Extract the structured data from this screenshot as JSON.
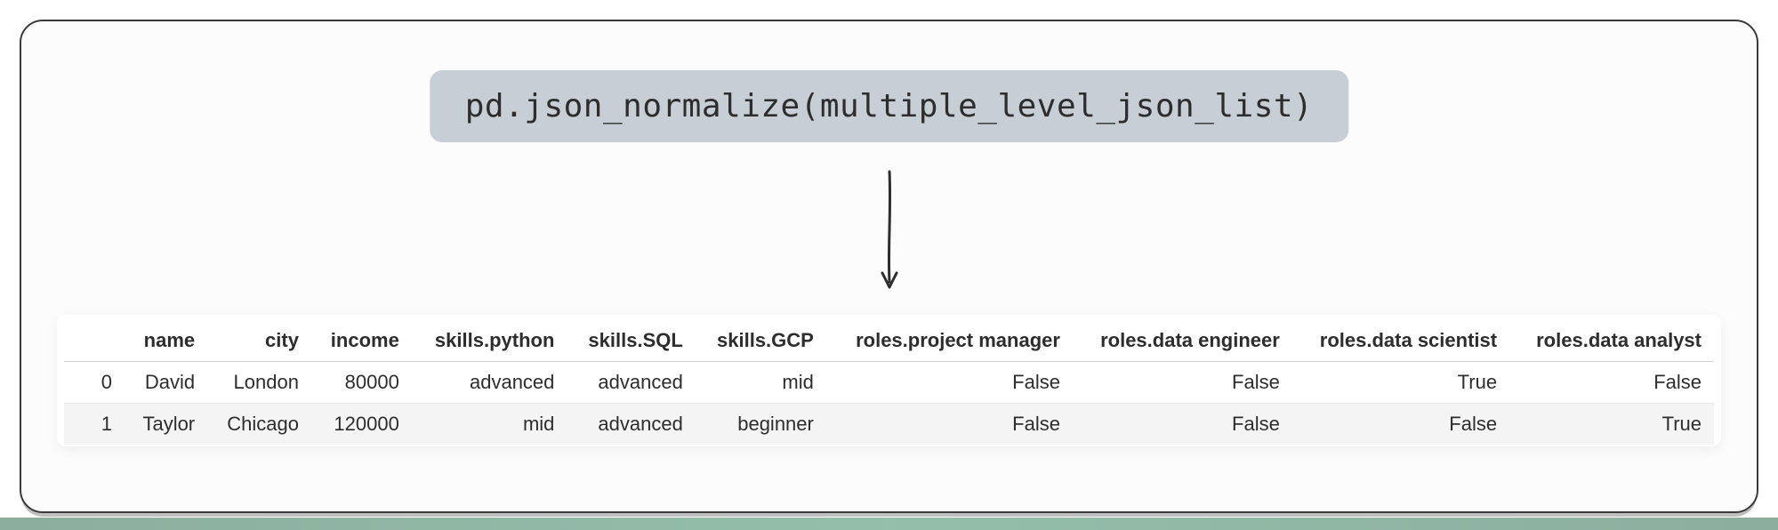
{
  "code_snippet": "pd.json_normalize(multiple_level_json_list)",
  "table": {
    "index_header": "",
    "columns": [
      "name",
      "city",
      "income",
      "skills.python",
      "skills.SQL",
      "skills.GCP",
      "roles.project manager",
      "roles.data engineer",
      "roles.data scientist",
      "roles.data analyst"
    ],
    "rows": [
      {
        "index": "0",
        "cells": [
          "David",
          "London",
          "80000",
          "advanced",
          "advanced",
          "mid",
          "False",
          "False",
          "True",
          "False"
        ]
      },
      {
        "index": "1",
        "cells": [
          "Taylor",
          "Chicago",
          "120000",
          "mid",
          "advanced",
          "beginner",
          "False",
          "False",
          "False",
          "True"
        ]
      }
    ]
  }
}
